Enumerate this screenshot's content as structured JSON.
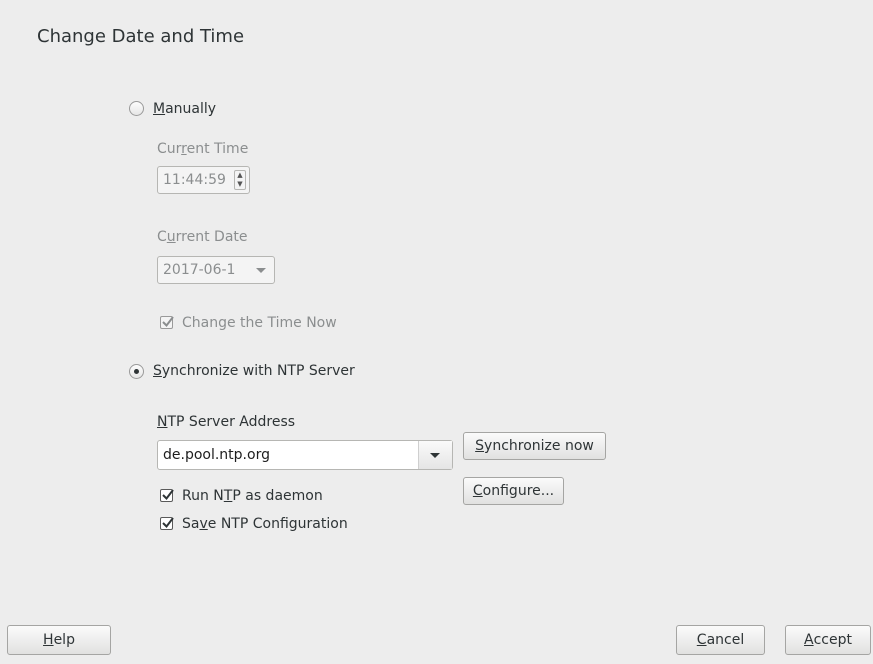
{
  "dialog": {
    "title": "Change Date and Time"
  },
  "manual": {
    "radio_label_prefix": "",
    "radio_label_mnemonic": "M",
    "radio_label_rest": "anually",
    "selected": false,
    "current_time_label_a": "Cur",
    "current_time_label_m": "r",
    "current_time_label_b": "ent Time",
    "current_time_value": "11:44:59",
    "current_date_label_a": "C",
    "current_date_label_m": "u",
    "current_date_label_b": "rrent Date",
    "current_date_value": "2017-06-1",
    "change_time_now_label": "Change the Time Now",
    "change_time_now_checked": true
  },
  "ntp": {
    "radio_label_mnemonic": "S",
    "radio_label_rest": "ynchronize with NTP Server",
    "selected": true,
    "server_address_label_mnemonic": "N",
    "server_address_label_rest": "TP Server Address",
    "server_address_value": "de.pool.ntp.org",
    "sync_now_mnemonic": "S",
    "sync_now_rest": "ynchronize now",
    "configure_prefix": "",
    "configure_mnemonic": "C",
    "configure_rest": "onfigure...",
    "run_daemon_a": "Run N",
    "run_daemon_m": "T",
    "run_daemon_b": "P as daemon",
    "run_daemon_checked": true,
    "save_config_a": "Sa",
    "save_config_m": "v",
    "save_config_b": "e NTP Configuration",
    "save_config_checked": true
  },
  "footer": {
    "help_mnemonic": "H",
    "help_rest": "elp",
    "cancel_mnemonic": "C",
    "cancel_rest": "ancel",
    "accept_mnemonic": "A",
    "accept_rest": "ccept"
  },
  "icons": {
    "checkmark": "checkmark-icon",
    "spin_up": "chevron-up-icon",
    "spin_down": "chevron-down-icon",
    "dropdown": "dropdown-arrow-icon"
  }
}
